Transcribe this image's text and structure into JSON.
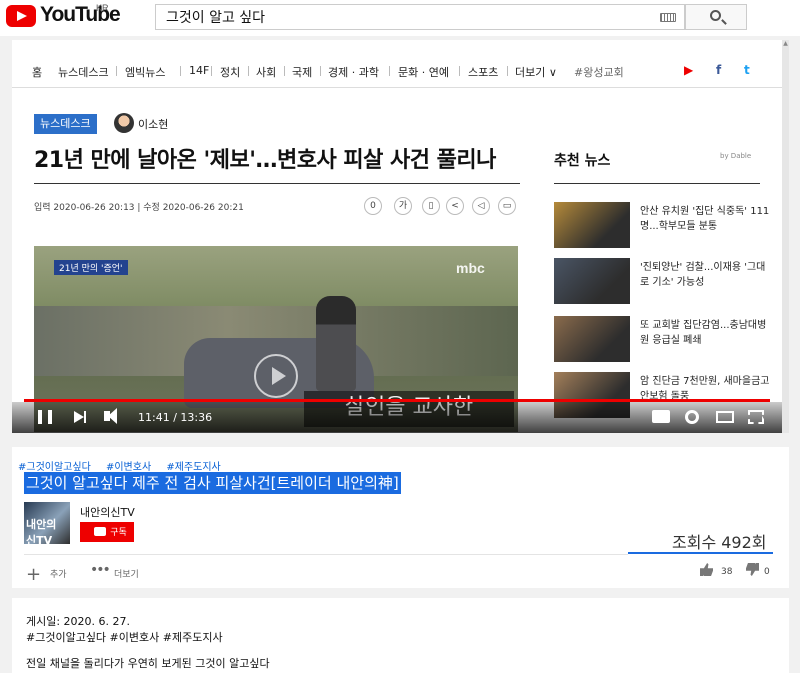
{
  "youtube": {
    "logo_text": "YouTube",
    "region": "KR",
    "search_value": "그것이 알고 싶다"
  },
  "news": {
    "nav_items": [
      "홈",
      "뉴스데스크",
      "엠빅뉴스",
      "14F",
      "정치",
      "사회",
      "국제",
      "경제 · 과학",
      "문화 · 연예",
      "스포츠",
      "더보기 ∨",
      "#왕성교회"
    ],
    "section_badge": "뉴스데스크",
    "author": "이소현",
    "headline": "21년 만에 날아온 '제보'…변호사 피살 사건 풀리나",
    "dates": "입력 2020-06-26 20:13 | 수정 2020-06-26 20:21",
    "comment_count": "0",
    "font_tool": "가",
    "recommended_title": "추천 뉴스",
    "dable": "by Dable",
    "recommended": [
      {
        "text": "안산 유치원 '집단 식중독' 111명...학부모들 분통",
        "color": "#b58a3a"
      },
      {
        "text": "'진퇴양난' 검찰...이재용 '그대로 기소' 가능성",
        "color": "#4a5565"
      },
      {
        "text": "또 교회발 집단감염...충남대병원 응급실 폐쇄",
        "color": "#8a6b4c"
      },
      {
        "text": "암 진단금 7천만원, 새마을금고 안보험 돌풍",
        "color": "#a37f5a"
      }
    ]
  },
  "video": {
    "caption_tag": "21년 만의 '증언'",
    "watermark": "mbc",
    "subtitle": "살인을 교사한",
    "time": "11:41 / 13:36",
    "progress": 1.0
  },
  "meta": {
    "tags": [
      "#그것이알고싶다",
      "#이변호사",
      "#제주도지사"
    ],
    "title": "그것이 알고싶다 제주 전 검사 피살사건[트레이더 내안의神]",
    "channel": "내안의신TV",
    "channel_avatar_text": "내안의 신TV",
    "subscribe": "구독",
    "views": "조회수 492회",
    "add_label": "추가",
    "more_label": "더보기",
    "likes": "38",
    "dislikes": "0"
  },
  "description": {
    "date": "게시일: 2020. 6. 27.",
    "tags": "#그것이알고싶다 #이변호사 #제주도지사",
    "text": "전일 채널을 돌리다가 우연히 보게된 그것이 알고싶다"
  }
}
